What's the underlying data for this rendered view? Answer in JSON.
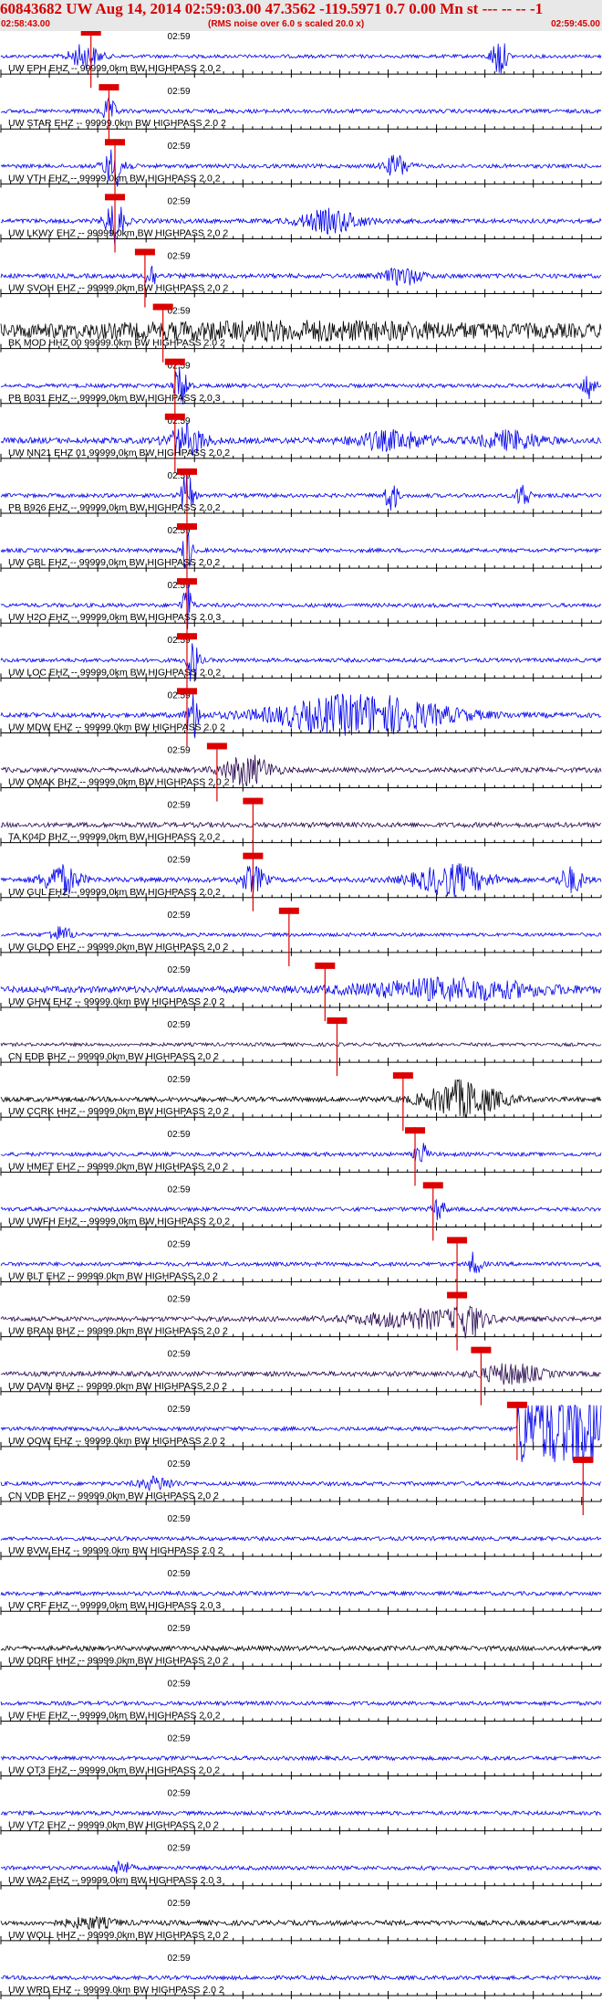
{
  "header": {
    "title": "60843682 UW Aug 14, 2014 02:59:03.00   47.3562 -119.5971  0.7 0.00 Mn st --- -- --   -1",
    "time_start": "02:58:43.00",
    "time_end": "02:59:45.00",
    "noise_note": "(RMS noise over 6.0 s scaled 20.0 x)"
  },
  "colors": {
    "trace_blue": "#0000ee",
    "trace_black": "#000000",
    "trace_purple": "#2a0a50",
    "pick_red": "#dd0000",
    "axis": "#000000",
    "header_bg": "#e8e8e8"
  },
  "chart_data": {
    "type": "line",
    "time_axis": {
      "start": "02:58:43.00",
      "end": "02:59:45.00",
      "minute_label": "02:59"
    },
    "traces": [
      {
        "label": "UW EPH EHZ -- 99999.0km BW  HIGHPASS  2.0  2",
        "color": "blue",
        "pick": 0.15,
        "amp": 0.07,
        "bursts": [
          [
            0.14,
            0.025,
            0.5
          ],
          [
            0.83,
            0.012,
            0.85
          ]
        ]
      },
      {
        "label": "UW STAR EHZ -- 99999.0km BW  HIGHPASS  2.0  2",
        "color": "blue",
        "pick": 0.18,
        "amp": 0.08,
        "bursts": [
          [
            0.18,
            0.012,
            0.45
          ]
        ]
      },
      {
        "label": "UW VTH EHZ -- 99999.0km BW  HIGHPASS  2.0  2",
        "color": "blue",
        "pick": 0.19,
        "amp": 0.08,
        "bursts": [
          [
            0.19,
            0.018,
            0.8
          ],
          [
            0.66,
            0.02,
            0.45
          ]
        ]
      },
      {
        "label": "UW LKWY EHZ -- 99999.0km BW  HIGHPASS  2.0  2",
        "color": "blue",
        "pick": 0.19,
        "amp": 0.09,
        "bursts": [
          [
            0.19,
            0.015,
            0.9
          ],
          [
            0.55,
            0.05,
            0.45
          ]
        ]
      },
      {
        "label": "UW SVOH EHZ -- 99999.0km BW  HIGHPASS  2.0  2",
        "color": "blue",
        "pick": 0.24,
        "amp": 0.09,
        "bursts": [
          [
            0.25,
            0.01,
            0.5
          ],
          [
            0.67,
            0.03,
            0.35
          ]
        ]
      },
      {
        "label": "BK MOD HHZ 00 99999.0km BW  HIGHPASS  2.0  2",
        "color": "black",
        "pick": 0.27,
        "amp": 0.28,
        "bursts": [
          [
            0.5,
            0.3,
            0.18
          ]
        ]
      },
      {
        "label": "PB B031 EHZ -- 99999.0km BW  HIGHPASS  2.0  3",
        "color": "blue",
        "pick": 0.29,
        "amp": 0.08,
        "bursts": [
          [
            0.3,
            0.012,
            0.85
          ],
          [
            0.98,
            0.01,
            0.6
          ]
        ]
      },
      {
        "label": "UW NN21 EHZ 01 99999.0km BW  HIGHPASS  2.0  2",
        "color": "blue",
        "pick": 0.29,
        "amp": 0.12,
        "bursts": [
          [
            0.31,
            0.03,
            0.6
          ],
          [
            0.65,
            0.06,
            0.35
          ],
          [
            0.85,
            0.05,
            0.35
          ]
        ]
      },
      {
        "label": "PB B926 EHZ -- 99999.0km BW  HIGHPASS  2.0  2",
        "color": "blue",
        "pick": 0.31,
        "amp": 0.08,
        "bursts": [
          [
            0.31,
            0.01,
            0.9
          ],
          [
            0.65,
            0.01,
            0.7
          ],
          [
            0.87,
            0.01,
            0.6
          ]
        ]
      },
      {
        "label": "UW GBL EHZ -- 99999.0km BW  HIGHPASS  2.0  2",
        "color": "blue",
        "pick": 0.31,
        "amp": 0.08,
        "bursts": [
          [
            0.31,
            0.008,
            0.95
          ]
        ]
      },
      {
        "label": "UW H2O EHZ -- 99999.0km BW  HIGHPASS  2.0  3",
        "color": "blue",
        "pick": 0.31,
        "amp": 0.08,
        "bursts": [
          [
            0.31,
            0.008,
            0.95
          ]
        ]
      },
      {
        "label": "UW LOC EHZ -- 99999.0km BW  HIGHPASS  2.0  2",
        "color": "blue",
        "pick": 0.31,
        "amp": 0.08,
        "bursts": [
          [
            0.32,
            0.01,
            0.95
          ]
        ]
      },
      {
        "label": "UW MDW EHZ -- 99999.0km BW  HIGHPASS  2.0  2",
        "color": "blue",
        "pick": 0.31,
        "amp": 0.1,
        "bursts": [
          [
            0.32,
            0.01,
            0.95
          ],
          [
            0.6,
            0.14,
            0.8
          ]
        ]
      },
      {
        "label": "UW OMAK BHZ -- 99999.0km BW  HIGHPASS  2.0  2",
        "color": "purple",
        "pick": 0.36,
        "amp": 0.1,
        "bursts": [
          [
            0.41,
            0.04,
            0.6
          ]
        ]
      },
      {
        "label": "TA K04D BHZ -- 99999.0km BW  HIGHPASS  2.0  2",
        "color": "purple",
        "pick": 0.42,
        "amp": 0.1,
        "bursts": []
      },
      {
        "label": "UW GUL EHZ -- 99999.0km BW  HIGHPASS  2.0  2",
        "color": "blue",
        "pick": 0.42,
        "amp": 0.1,
        "bursts": [
          [
            0.1,
            0.03,
            0.6
          ],
          [
            0.42,
            0.02,
            0.55
          ],
          [
            0.75,
            0.06,
            0.6
          ],
          [
            0.95,
            0.02,
            0.5
          ]
        ]
      },
      {
        "label": "UW GLDO EHZ -- 99999.0km BW  HIGHPASS  2.0  2",
        "color": "blue",
        "pick": 0.48,
        "amp": 0.07,
        "bursts": [
          [
            0.1,
            0.02,
            0.3
          ]
        ]
      },
      {
        "label": "UW GHW EHZ -- 99999.0km BW  HIGHPASS  2.0  2",
        "color": "blue",
        "pick": 0.54,
        "amp": 0.13,
        "bursts": [
          [
            0.75,
            0.15,
            0.4
          ]
        ]
      },
      {
        "label": "CN EDB BHZ -- 99999.0km BW  HIGHPASS  2.0  2",
        "color": "purple",
        "pick": 0.56,
        "amp": 0.07,
        "bursts": []
      },
      {
        "label": "UW CCRK HHZ -- 99999.0km BW  HIGHPASS  2.0  2",
        "color": "black",
        "pick": 0.67,
        "amp": 0.1,
        "bursts": [
          [
            0.77,
            0.06,
            0.75
          ]
        ]
      },
      {
        "label": "UW HMET EHZ -- 99999.0km BW  HIGHPASS  2.0  2",
        "color": "blue",
        "pick": 0.69,
        "amp": 0.08,
        "bursts": [
          [
            0.7,
            0.01,
            0.5
          ]
        ]
      },
      {
        "label": "UW UWFH EHZ -- 99999.0km BW  HIGHPASS  2.0  2",
        "color": "blue",
        "pick": 0.72,
        "amp": 0.08,
        "bursts": [
          [
            0.73,
            0.01,
            0.45
          ]
        ]
      },
      {
        "label": "UW BLT EHZ -- 99999.0km BW  HIGHPASS  2.0  2",
        "color": "blue",
        "pick": 0.76,
        "amp": 0.08,
        "bursts": [
          [
            0.79,
            0.01,
            0.5
          ]
        ]
      },
      {
        "label": "UW BRAN BHZ -- 99999.0km BW  HIGHPASS  2.0  2",
        "color": "purple",
        "pick": 0.76,
        "amp": 0.1,
        "bursts": [
          [
            0.7,
            0.1,
            0.35
          ],
          [
            0.78,
            0.02,
            0.55
          ]
        ]
      },
      {
        "label": "UW DAVN BHZ -- 99999.0km BW  HIGHPASS  2.0  2",
        "color": "purple",
        "pick": 0.8,
        "amp": 0.1,
        "bursts": [
          [
            0.85,
            0.05,
            0.4
          ]
        ]
      },
      {
        "label": "UW OOW EHZ -- 99999.0km BW  HIGHPASS  2.0  2",
        "color": "blue",
        "pick": 0.86,
        "amp": 0.08,
        "bursts": [],
        "clip_from": 0.86
      },
      {
        "label": "CN VDB EHZ -- 99999.0km BW  HIGHPASS  2.0  2",
        "color": "blue",
        "pick": 0.97,
        "amp": 0.08,
        "bursts": [
          [
            0.26,
            0.03,
            0.25
          ]
        ]
      },
      {
        "label": "UW BVW EHZ -- 99999.0km BW  HIGHPASS  2.0  2",
        "color": "blue",
        "pick": null,
        "amp": 0.08,
        "bursts": []
      },
      {
        "label": "UW CRF EHZ -- 99999.0km BW  HIGHPASS  2.0  3",
        "color": "blue",
        "pick": null,
        "amp": 0.08,
        "bursts": []
      },
      {
        "label": "UW DDRF HHZ -- 99999.0km BW  HIGHPASS  2.0  2",
        "color": "black",
        "pick": null,
        "amp": 0.1,
        "bursts": []
      },
      {
        "label": "UW FHE EHZ -- 99999.0km BW  HIGHPASS  2.0  2",
        "color": "blue",
        "pick": null,
        "amp": 0.08,
        "bursts": []
      },
      {
        "label": "UW OT3 EHZ -- 99999.0km BW  HIGHPASS  2.0  2",
        "color": "blue",
        "pick": null,
        "amp": 0.08,
        "bursts": []
      },
      {
        "label": "UW VT2 EHZ -- 99999.0km BW  HIGHPASS  2.0  2",
        "color": "blue",
        "pick": null,
        "amp": 0.08,
        "bursts": []
      },
      {
        "label": "UW WA2 EHZ -- 99999.0km BW  HIGHPASS  2.0  3",
        "color": "blue",
        "pick": null,
        "amp": 0.08,
        "bursts": [
          [
            0.2,
            0.015,
            0.3
          ]
        ]
      },
      {
        "label": "UW WOLL HHZ -- 99999.0km BW  HIGHPASS  2.0  2",
        "color": "black",
        "pick": null,
        "amp": 0.1,
        "bursts": [
          [
            0.15,
            0.04,
            0.2
          ]
        ]
      },
      {
        "label": "UW WRD EHZ -- 99999.0km BW  HIGHPASS  2.0  2",
        "color": "blue",
        "pick": null,
        "amp": 0.08,
        "bursts": []
      }
    ]
  }
}
